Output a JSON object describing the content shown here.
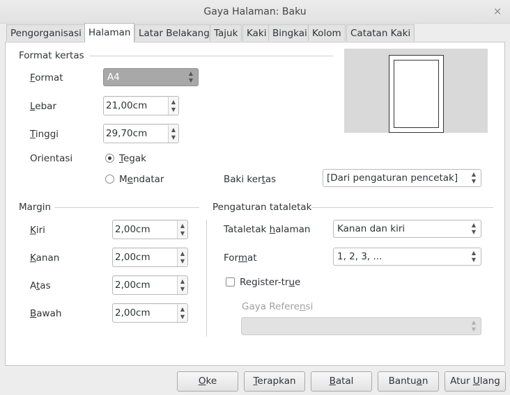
{
  "window": {
    "title": "Gaya Halaman: Baku",
    "close_glyph": "×"
  },
  "tabs": [
    "Pengorganisasi",
    "Halaman",
    "Latar Belakang",
    "Tajuk",
    "Kaki",
    "Bingkai",
    "Kolom",
    "Catatan Kaki"
  ],
  "active_tab": "Halaman",
  "paper_format": {
    "section_title": "Format kertas",
    "format": {
      "label_u": "F",
      "label_rest": "ormat",
      "value": "A4"
    },
    "width": {
      "label_u": "L",
      "label_rest": "ebar",
      "value": "21,00cm"
    },
    "height": {
      "label_u": "T",
      "label_rest": "inggi",
      "value": "29,70cm"
    },
    "orientation_label": "Orientasi",
    "portrait": {
      "pre": "",
      "u": "T",
      "rest": "egak",
      "checked": true
    },
    "landscape": {
      "pre": "M",
      "u": "e",
      "rest": "ndatar",
      "checked": false
    },
    "tray": {
      "label_pre": "Baki ker",
      "label_u": "t",
      "label_rest": "as",
      "value": "[Dari pengaturan pencetak]"
    }
  },
  "margins": {
    "section_title": "Margin",
    "left": {
      "label_u": "K",
      "label_rest": "iri",
      "value": "2,00cm"
    },
    "right": {
      "label_u": "K",
      "label_rest": "anan",
      "value": "2,00cm"
    },
    "top": {
      "label_pre": "A",
      "label_u": "t",
      "label_rest": "as",
      "value": "2,00cm"
    },
    "bottom": {
      "label_u": "B",
      "label_rest": "awah",
      "value": "2,00cm"
    }
  },
  "layout": {
    "section_title": "Pengaturan tataletak",
    "page_layout": {
      "label_pre": "Tataletak ",
      "label_u": "h",
      "label_rest": "alaman",
      "value": "Kanan dan kiri"
    },
    "format": {
      "label_pre": "For",
      "label_u": "m",
      "label_rest": "at",
      "value": "1, 2, 3, ..."
    },
    "register_true": {
      "label_pre": "Register-tr",
      "label_u": "u",
      "label_rest": "e",
      "checked": false
    },
    "reference_style": {
      "label_pre": "Gaya Refere",
      "label_u": "n",
      "label_rest": "si",
      "value": ""
    }
  },
  "buttons": {
    "ok": {
      "u": "O",
      "rest": "ke"
    },
    "apply": {
      "u": "T",
      "rest": "erapkan"
    },
    "cancel": {
      "u": "B",
      "rest": "atal"
    },
    "help": {
      "pre": "Bantu",
      "u": "a",
      "rest": "n"
    },
    "reset": {
      "pre": "Atur ",
      "u": "U",
      "rest": "lang"
    }
  },
  "icons": {
    "spin_up": "▲",
    "spin_down": "▼",
    "close": "close-icon"
  }
}
